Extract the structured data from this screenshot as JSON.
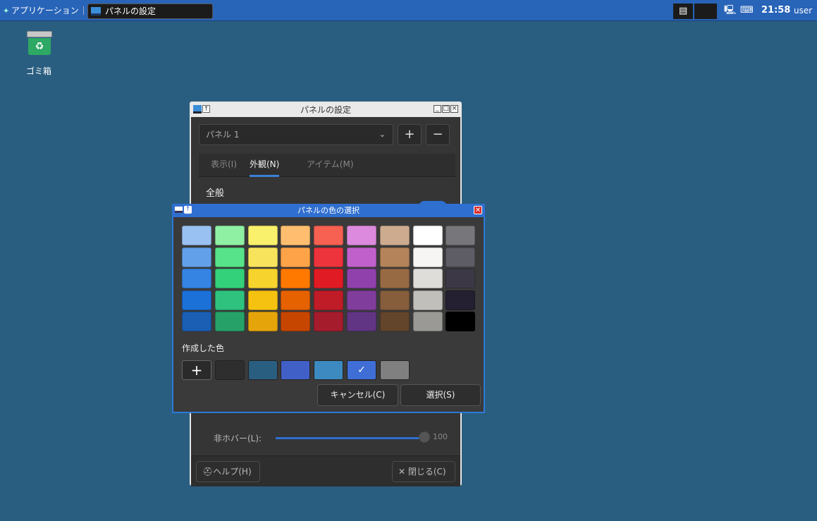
{
  "top_panel": {
    "applications_label": "アプリケーション",
    "task_button_label": "パネルの設定",
    "clock": "21:58",
    "username": "user"
  },
  "desktop": {
    "trash_label": "ゴミ箱",
    "icons": [
      "trash-icon"
    ]
  },
  "settings_window": {
    "title": "パネルの設定",
    "panel_select_value": "パネル 1",
    "add_label": "+",
    "remove_label": "−",
    "tabs": [
      {
        "label": "表示(I)",
        "active": false
      },
      {
        "label": "外観(N)",
        "active": true
      },
      {
        "label": "アイテム(M)",
        "active": false
      }
    ],
    "section_title": "全般",
    "hover_label": "非ホバー(L):",
    "slider_value": "100",
    "help_label": "ヘルプ(H)",
    "close_label": "閉じる(C)"
  },
  "color_dialog": {
    "title": "パネルの色の選択",
    "palette_columns": [
      [
        "#99c1f1",
        "#62a0ea",
        "#3584e4",
        "#1c71d8",
        "#1a5fb4"
      ],
      [
        "#8ff0a4",
        "#57e389",
        "#33d17a",
        "#2ec27e",
        "#26a269"
      ],
      [
        "#f9f06b",
        "#f8e45c",
        "#f6d32d",
        "#f5c211",
        "#e5a50a"
      ],
      [
        "#ffbe6f",
        "#ffa348",
        "#ff7800",
        "#e66100",
        "#c64600"
      ],
      [
        "#f66151",
        "#ed333b",
        "#e01b24",
        "#c01c28",
        "#a51d2d"
      ],
      [
        "#dc8add",
        "#c061cb",
        "#9141ac",
        "#813d9c",
        "#613583"
      ],
      [
        "#cdab8f",
        "#b5835a",
        "#986a44",
        "#865e3c",
        "#63452c"
      ],
      [
        "#ffffff",
        "#f6f5f4",
        "#deddda",
        "#c0bfbc",
        "#9a9996"
      ],
      [
        "#77767b",
        "#5e5c64",
        "#3d3846",
        "#241f31",
        "#000000"
      ]
    ],
    "custom_label": "作成した色",
    "custom_add_label": "+",
    "custom_colors": [
      "#2e2e2e",
      "#2a5e80",
      "#4060c8",
      "#3c8ac0",
      "#3f6ed6",
      "#808080"
    ],
    "selected_custom_index": 4,
    "cancel_label": "キャンセル(C)",
    "select_label": "選択(S)"
  }
}
